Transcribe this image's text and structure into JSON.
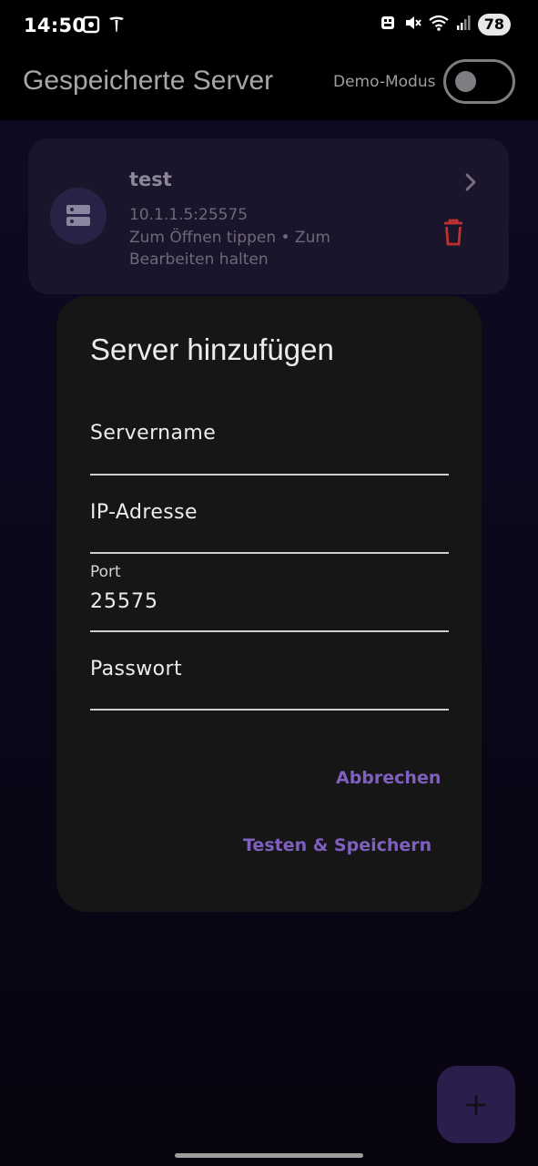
{
  "status_bar": {
    "time": "14:50",
    "battery": "78",
    "icons": [
      "screenshot-icon",
      "tesla-icon",
      "car-icon",
      "mute-icon",
      "wifi-icon",
      "signal-icon"
    ]
  },
  "app_bar": {
    "title": "Gespeicherte Server",
    "demo_label": "Demo-Modus",
    "demo_enabled": false
  },
  "server_card": {
    "name": "test",
    "address": "10.1.1.5:25575",
    "hint": "Zum Öffnen tippen • Zum Bearbeiten halten",
    "icons": [
      "server-icon",
      "chevron-right-icon",
      "trash-icon"
    ]
  },
  "dialog": {
    "title": "Server hinzufügen",
    "fields": {
      "name": {
        "placeholder": "Servername",
        "value": ""
      },
      "ip": {
        "placeholder": "IP-Adresse",
        "value": ""
      },
      "port": {
        "label": "Port",
        "value": "25575"
      },
      "password": {
        "placeholder": "Passwort",
        "value": ""
      }
    },
    "cancel_label": "Abbrechen",
    "save_label": "Testen & Speichern"
  },
  "fab": {
    "icon": "plus-icon"
  },
  "colors": {
    "accent": "#7f5fc0",
    "danger": "#c0302e",
    "dialog_bg": "#161616",
    "card_bg": "#1b152b"
  }
}
